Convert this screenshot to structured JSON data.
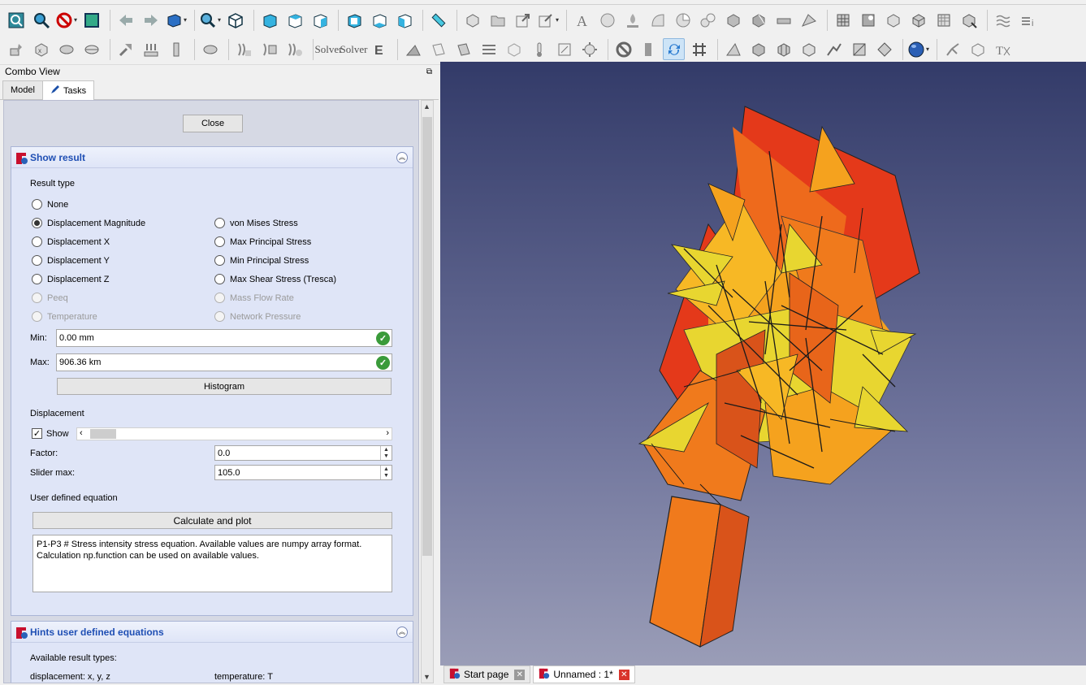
{
  "combo_view": {
    "title": "Combo View",
    "float_icon": "undock-icon",
    "tabs": [
      {
        "label": "Model",
        "active": false
      },
      {
        "label": "Tasks",
        "active": true
      }
    ]
  },
  "close_label": "Close",
  "show_result": {
    "title": "Show result",
    "result_type_label": "Result type",
    "radio_left": [
      {
        "label": "None",
        "checked": false,
        "enabled": true
      },
      {
        "label": "Displacement Magnitude",
        "checked": true,
        "enabled": true
      },
      {
        "label": "Displacement X",
        "checked": false,
        "enabled": true
      },
      {
        "label": "Displacement Y",
        "checked": false,
        "enabled": true
      },
      {
        "label": "Displacement Z",
        "checked": false,
        "enabled": true
      },
      {
        "label": "Peeq",
        "checked": false,
        "enabled": false
      },
      {
        "label": "Temperature",
        "checked": false,
        "enabled": false
      }
    ],
    "radio_right": [
      {
        "label": "von Mises Stress",
        "checked": false,
        "enabled": true
      },
      {
        "label": "Max Principal Stress",
        "checked": false,
        "enabled": true
      },
      {
        "label": "Min Principal Stress",
        "checked": false,
        "enabled": true
      },
      {
        "label": "Max Shear Stress (Tresca)",
        "checked": false,
        "enabled": true
      },
      {
        "label": "Mass Flow Rate",
        "checked": false,
        "enabled": false
      },
      {
        "label": "Network Pressure",
        "checked": false,
        "enabled": false
      }
    ],
    "min_label": "Min:",
    "min_value": "0.00 mm",
    "max_label": "Max:",
    "max_value": "906.36 km",
    "histogram_label": "Histogram",
    "displacement_label": "Displacement",
    "show_label": "Show",
    "show_checked": true,
    "factor_label": "Factor:",
    "factor_value": "0.0",
    "slider_max_label": "Slider max:",
    "slider_max_value": "105.0",
    "user_eq_label": "User defined equation",
    "calc_plot_label": "Calculate and plot",
    "equation_line1": "P1-P3 # Stress intensity stress equation. Available values are numpy array format.",
    "equation_line2": "Calculation np.function can be used on available values."
  },
  "hints": {
    "title": "Hints user defined equations",
    "available_label": "Available result types:",
    "col1": "displacement: x, y, z",
    "col2": "temperature: T"
  },
  "bottom_tabs": [
    {
      "label": "Start page",
      "active": false
    },
    {
      "label": "Unnamed : 1*",
      "active": true
    }
  ],
  "colors": {
    "viewport_top": "#333b69",
    "viewport_bottom": "#9a9db7",
    "group_title": "#1f4fb4",
    "mesh_red": "#e4391a",
    "mesh_orange": "#f07a1c",
    "mesh_yellow": "#e8d630"
  }
}
